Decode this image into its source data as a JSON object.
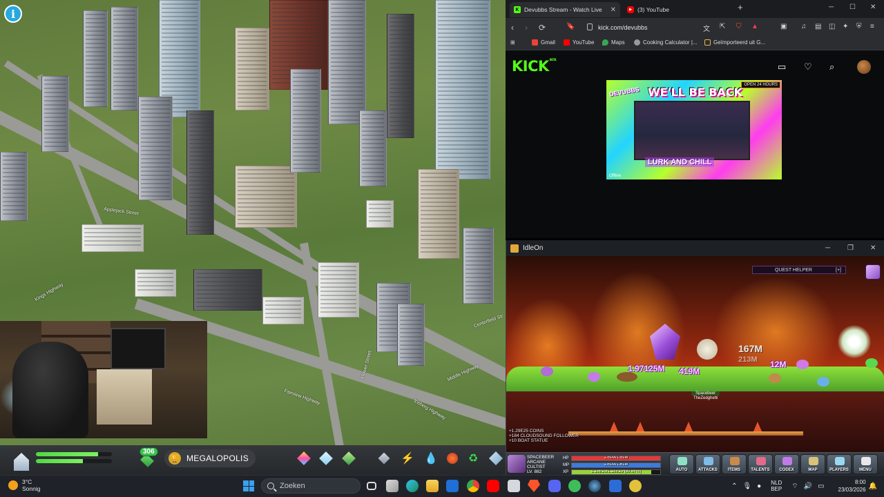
{
  "city": {
    "streets": [
      "Applejack Street",
      "Fairview Highway",
      "Middle Highway",
      "Kings Highway",
      "Centerfield Str",
      "Flower Street",
      "Iceberg Highway"
    ],
    "hud": {
      "population": "306",
      "milestone": "MEGALOPOLIS",
      "health_level": 0.82,
      "happiness_level": 0.62
    }
  },
  "taskbar": {
    "weather_temp": "3°C",
    "weather_desc": "Sonnig",
    "search_placeholder": "Zoeken",
    "lang_top": "NLD",
    "lang_bottom": "BEP",
    "time": "8:00",
    "date": "23/03/2026"
  },
  "browser": {
    "tabs": [
      {
        "label": "Devubbs Stream - Watch Live",
        "favicon_color": "#53fc18",
        "favicon": "K"
      },
      {
        "label": "(3) YouTube",
        "favicon_color": "#ff0000",
        "favicon": "▶"
      }
    ],
    "new_tab": "+",
    "url": "kick.com/devubbs",
    "bookmarks": [
      {
        "label": "Gmail",
        "color": "#ea4335"
      },
      {
        "label": "YouTube",
        "color": "#ff0000"
      },
      {
        "label": "Maps",
        "color": "#34a853"
      },
      {
        "label": "Cooking Calculator |...",
        "color": "#999999"
      },
      {
        "label": "Geïmporteerd uit G...",
        "color": "#e8b84a"
      }
    ]
  },
  "kick": {
    "logo": "KICK",
    "beta": "BETA",
    "player_title": "WE'LL BE BACK",
    "player_brand": "DEVUBBS",
    "player_sub": "LURK AND CHILL",
    "player_open": "OPEN 24 HOURS",
    "player_offline": "Offline",
    "accent": "#53fc18"
  },
  "idleon": {
    "title": "IdleOn",
    "quest_helper": "QUEST HELPER",
    "quest_toggle": "[+]",
    "damage_numbers": [
      "167M",
      "213M",
      "1.97125M",
      "12M",
      "419M"
    ],
    "player_tag": "Spacebeer",
    "player_tag2": "TheZedghetti",
    "chat_lines": [
      "+1.29E25 COINS",
      "+184 CLOUDSOUND FOLLOWER",
      "+10 BOAT STATUE"
    ],
    "character": {
      "name": "SPACEBEER",
      "class1": "ARCANE",
      "class2": "CULTIST",
      "level": "LV. 882"
    },
    "stats": [
      {
        "label": "HP",
        "text": "1.51M/1.51M",
        "fill": 1.0,
        "color": "#e03a3a"
      },
      {
        "label": "MP",
        "text": "1.61M/1.61M",
        "fill": 1.0,
        "color": "#3a7be0"
      },
      {
        "label": "XP",
        "text": "1.15E25/1.28E25 (89.57%)",
        "fill": 0.8957,
        "color": "#9ad23a"
      }
    ],
    "buttons": [
      {
        "label": "AUTO",
        "color": "#8de0c4"
      },
      {
        "label": "ATTACKS",
        "color": "#7fbce8"
      },
      {
        "label": "ITEMS",
        "color": "#c98a4a"
      },
      {
        "label": "TALENTS",
        "color": "#e46a8a"
      },
      {
        "label": "CODEX",
        "color": "#c27ae8"
      },
      {
        "label": "MAP",
        "color": "#d8c27a"
      },
      {
        "label": "PLAYERS",
        "color": "#9ad8f0"
      },
      {
        "label": "MENU",
        "color": "#e8e8e8"
      }
    ]
  }
}
